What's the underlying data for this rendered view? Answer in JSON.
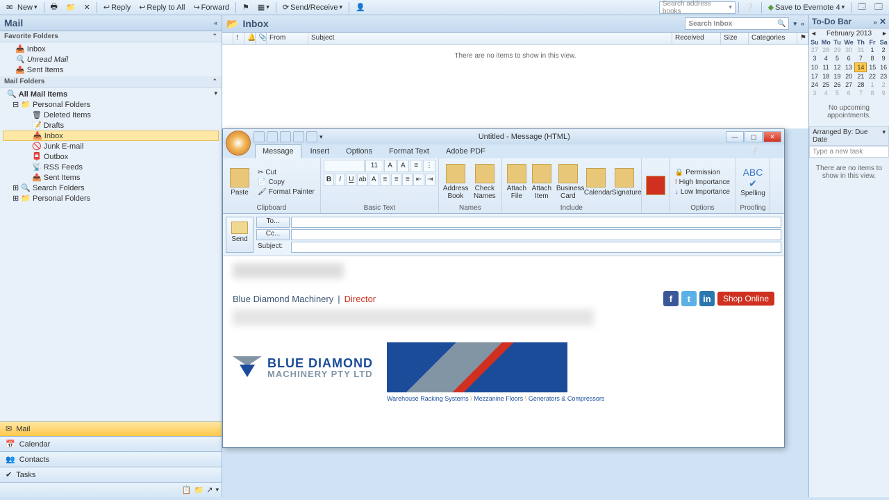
{
  "toolbar": {
    "new": "New",
    "reply": "Reply",
    "reply_all": "Reply to All",
    "forward": "Forward",
    "send_receive": "Send/Receive",
    "search_books_ph": "Search address books",
    "save_evernote": "Save to Evernote 4"
  },
  "nav": {
    "title": "Mail",
    "fav_hdr": "Favorite Folders",
    "fav": [
      "Inbox",
      "Unread Mail",
      "Sent Items"
    ],
    "folders_hdr": "Mail Folders",
    "all_items": "All Mail Items",
    "pf": "Personal Folders",
    "items": [
      "Deleted Items",
      "Drafts",
      "Inbox",
      "Junk E-mail",
      "Outbox",
      "RSS Feeds",
      "Sent Items",
      "Search Folders"
    ],
    "pf2": "Personal Folders",
    "btns": {
      "mail": "Mail",
      "calendar": "Calendar",
      "contacts": "Contacts",
      "tasks": "Tasks"
    }
  },
  "inbox": {
    "title": "Inbox",
    "search_ph": "Search Inbox",
    "cols": {
      "from": "From",
      "subject": "Subject",
      "received": "Received",
      "size": "Size",
      "categories": "Categories"
    },
    "empty": "There are no items to show in this view."
  },
  "todo": {
    "title": "To-Do Bar",
    "month": "February 2013",
    "days": [
      "Su",
      "Mo",
      "Tu",
      "We",
      "Th",
      "Fr",
      "Sa"
    ],
    "today": 14,
    "no_appt": "No upcoming appointments.",
    "arrange": "Arranged By: Due Date",
    "task_ph": "Type a new task",
    "no_tasks": "There are no items to show in this view."
  },
  "compose": {
    "title": "Untitled - Message (HTML)",
    "tabs": [
      "Message",
      "Insert",
      "Options",
      "Format Text",
      "Adobe PDF"
    ],
    "groups": {
      "clipboard": {
        "paste": "Paste",
        "cut": "Cut",
        "copy": "Copy",
        "fp": "Format Painter",
        "label": "Clipboard"
      },
      "font": {
        "label": "Basic Text",
        "size": "11"
      },
      "names": {
        "ab": "Address Book",
        "cn": "Check Names",
        "label": "Names"
      },
      "include": {
        "af": "Attach File",
        "ai": "Attach Item",
        "bc": "Business Card",
        "cal": "Calendar",
        "sig": "Signature",
        "label": "Include"
      },
      "follow": "Follow Up",
      "options": {
        "perm": "Permission",
        "hi": "High Importance",
        "lo": "Low Importance",
        "label": "Options"
      },
      "proof": {
        "sp": "Spelling",
        "label": "Proofing"
      }
    },
    "addr": {
      "send": "Send",
      "to": "To...",
      "cc": "Cc...",
      "subject": "Subject:"
    },
    "sig": {
      "company": "Blue Diamond Machinery",
      "sep": " | ",
      "role": "Director",
      "shop": "Shop Online",
      "logo1": "BLUE DIAMOND",
      "logo2": "MACHINERY PTY LTD",
      "tagline_a": "Warehouse Racking Systems",
      "tagline_b": "Mezzanine Floors",
      "tagline_c": "Generators & Compressors"
    }
  }
}
